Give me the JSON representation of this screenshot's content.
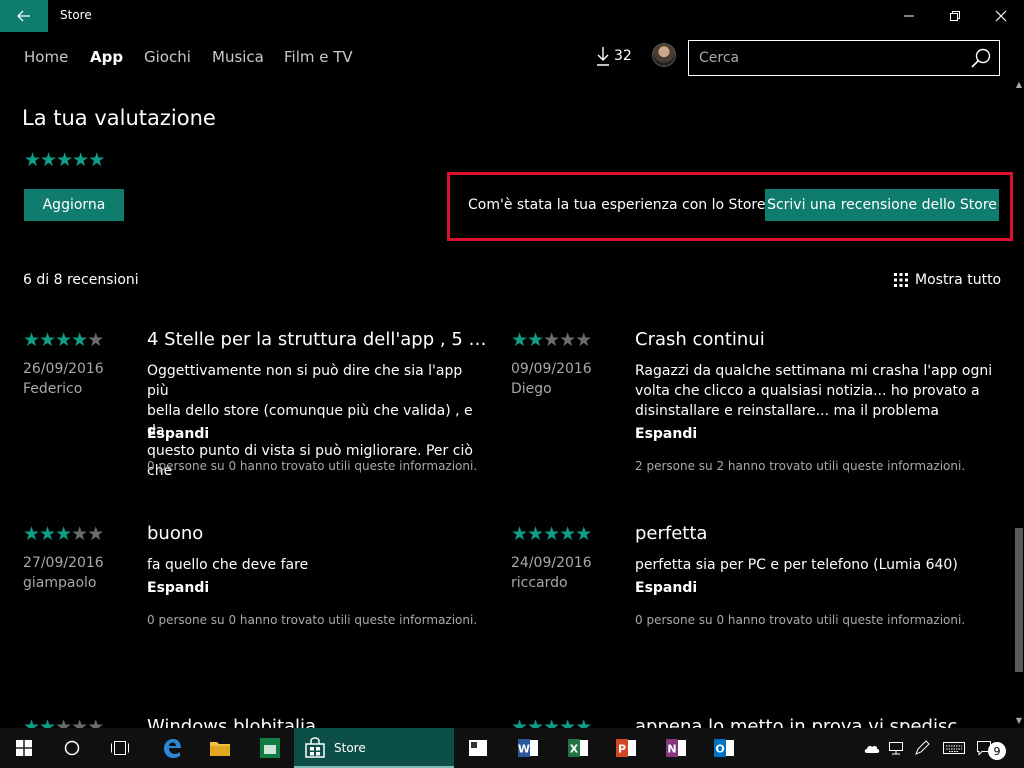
{
  "window": {
    "title": "Store"
  },
  "nav": {
    "items": [
      {
        "label": "Home",
        "active": false
      },
      {
        "label": "App",
        "active": true
      },
      {
        "label": "Giochi",
        "active": false
      },
      {
        "label": "Musica",
        "active": false
      },
      {
        "label": "Film e TV",
        "active": false
      }
    ],
    "downloads_count": "32",
    "search_placeholder": "Cerca"
  },
  "rating_section": {
    "title": "La tua valutazione",
    "my_rating": 5,
    "update_label": "Aggiorna",
    "experience_question": "Com'è stata la tua esperienza con lo Store?",
    "write_review_label": "Scrivi una recensione dello Store"
  },
  "reviews_header": {
    "count_text": "6 di 8 recensioni",
    "show_all_label": "Mostra tutto"
  },
  "reviews": [
    {
      "rating": 4,
      "date": "26/09/2016",
      "author": "Federico",
      "title": "4 Stelle per la struttura dell'app , 5 p...",
      "body": [
        "Oggettivamente non si può dire che sia l'app più",
        "bella dello store (comunque più che valida) , e da",
        "questo punto di vista si può migliorare. Per ciò che"
      ],
      "expand_label": "Espandi",
      "helpful": "0 persone su 0 hanno trovato utili queste informazioni."
    },
    {
      "rating": 2,
      "date": "09/09/2016",
      "author": "Diego",
      "title": "Crash continui",
      "body": [
        "Ragazzi da qualche settimana mi crasha l'app ogni",
        "volta che clicco a qualsiasi notizia... ho provato a",
        "disinstallare e reinstallare... ma il problema"
      ],
      "expand_label": "Espandi",
      "helpful": "2 persone su 2 hanno trovato utili queste informazioni."
    },
    {
      "rating": 3,
      "date": "27/09/2016",
      "author": "giampaolo",
      "title": "buono",
      "body": [
        "fa quello che deve fare"
      ],
      "expand_label": "Espandi",
      "helpful": "0 persone su 0 hanno trovato utili queste informazioni."
    },
    {
      "rating": 5,
      "date": "24/09/2016",
      "author": "riccardo",
      "title": "perfetta",
      "body": [
        "perfetta sia per PC e per telefono (Lumia 640)"
      ],
      "expand_label": "Espandi",
      "helpful": "0 persone su 0 hanno trovato utili queste informazioni."
    },
    {
      "rating": 2,
      "title": "Windows blobitalia"
    },
    {
      "rating": 5,
      "title": "appena lo metto in prova vi spedisc"
    }
  ],
  "taskbar": {
    "store_label": "Store",
    "notification_count": "9",
    "apps": [
      "start-icon",
      "cortana-icon",
      "task-view-icon",
      "edge-icon",
      "file-explorer-icon",
      "app-icon",
      "store-icon",
      "tablet-app-icon",
      "word-icon",
      "excel-icon",
      "powerpoint-icon",
      "onenote-icon",
      "outlook-icon"
    ]
  },
  "colors": {
    "accent": "#0f7d6e",
    "star_on": "#0f9f86",
    "star_off": "#6b6b6b",
    "highlight": "#e0102a"
  }
}
